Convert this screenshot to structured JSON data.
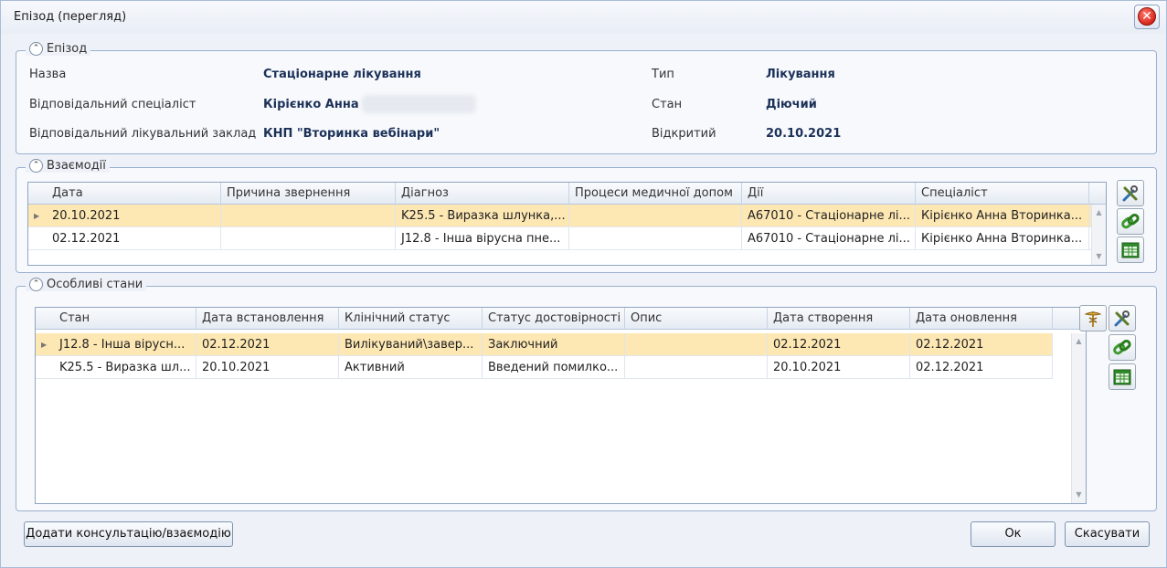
{
  "window": {
    "title": "Епізод (перегляд)"
  },
  "episode": {
    "legend": "Епізод",
    "fields": {
      "name_label": "Назва",
      "name_value": "Стаціонарне лікування",
      "specialist_label": "Відповідальний спеціаліст",
      "specialist_value": "Кірієнко Анна",
      "facility_label": "Відповідальний лікувальний заклад",
      "facility_value": "КНП \"Вторинка вебінари\"",
      "type_label": "Тип",
      "type_value": "Лікування",
      "state_label": "Стан",
      "state_value": "Діючий",
      "opened_label": "Відкритий",
      "opened_value": "20.10.2021"
    }
  },
  "interactions": {
    "legend": "Взаємодії",
    "columns": [
      "Дата",
      "Причина звернення",
      "Діагноз",
      "Процеси медичної допом",
      "Дії",
      "Спеціаліст"
    ],
    "rows": [
      [
        "20.10.2021",
        "",
        "K25.5 - Виразка шлунка,...",
        "",
        "A67010 - Стаціонарне лі...",
        "Кірієнко Анна Вторинка..."
      ],
      [
        "02.12.2021",
        "",
        "J12.8 - Інша вірусна пне...",
        "",
        "A67010 - Стаціонарне лі...",
        "Кірієнко Анна Вторинка..."
      ]
    ]
  },
  "conditions": {
    "legend": "Особливі стани",
    "columns": [
      "Стан",
      "Дата встановлення",
      "Клінічний статус",
      "Статус достовірності",
      "Опис",
      "Дата створення",
      "Дата оновлення"
    ],
    "rows": [
      [
        "J12.8 - Інша вірусн...",
        "02.12.2021",
        "Вилікуваний\\завер...",
        "Заключний",
        "",
        "02.12.2021",
        "02.12.2021"
      ],
      [
        "K25.5 - Виразка шл...",
        "20.10.2021",
        "Активний",
        "Введений помилко...",
        "",
        "20.10.2021",
        "02.12.2021"
      ]
    ]
  },
  "buttons": {
    "add_consultation": "Додати консультацію/взаємодію",
    "ok": "Ок",
    "cancel": "Скасувати"
  },
  "icons": {
    "close": "close-icon",
    "collapse": "chevron-up-icon",
    "edit": "tools-icon",
    "link": "chain-link-icon",
    "export": "spreadsheet-icon",
    "medical": "caduceus-icon"
  }
}
